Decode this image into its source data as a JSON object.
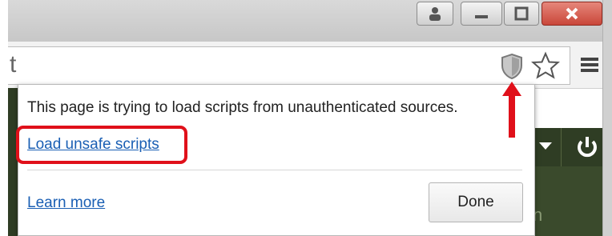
{
  "address_bar": {
    "text": "t"
  },
  "popup": {
    "message": "This page is trying to load scripts from unauthenticated sources.",
    "load_unsafe_label": "Load unsafe scripts",
    "learn_more_label": "Learn more",
    "done_label": "Done"
  },
  "page_fragments": {
    "bottom_right_text": "n"
  },
  "icons": [
    "user-icon",
    "minimize-icon",
    "maximize-icon",
    "close-icon",
    "shield-icon",
    "star-icon",
    "menu-icon",
    "dropdown-arrow-icon",
    "power-icon",
    "red-arrow-icon"
  ],
  "colors": {
    "highlight": "#e0101a",
    "link": "#1a5fb4",
    "page_dark": "#3a4a2c"
  }
}
